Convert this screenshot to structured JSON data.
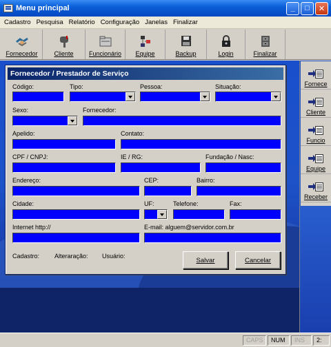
{
  "window": {
    "title": "Menu principal",
    "minimize": "_",
    "maximize": "□",
    "close": "✕"
  },
  "menu": [
    "Cadastro",
    "Pesquisa",
    "Relatório",
    "Configuração",
    "Janelas",
    "Finalizar"
  ],
  "toolbar": [
    {
      "label": "Fornecedor",
      "icon": "handshake-icon"
    },
    {
      "label": "Cliente",
      "icon": "mailbox-icon"
    },
    {
      "label": "Funcionário",
      "icon": "folder-icon"
    },
    {
      "label": "Equipe",
      "icon": "network-icon"
    },
    {
      "label": "Backup",
      "icon": "floppy-icon"
    },
    {
      "label": "Login",
      "icon": "lock-icon"
    },
    {
      "label": "Finalizar",
      "icon": "cabinet-icon"
    }
  ],
  "side": [
    "Fornece",
    "Cliente",
    "Funcio",
    "Equipe",
    "Receber"
  ],
  "status": [
    "CAPS",
    "NUM",
    "INS",
    "2:"
  ],
  "dialog": {
    "title": "Fornecedor / Prestador de Serviço",
    "labels": {
      "codigo": "Código:",
      "tipo": "Tipo:",
      "pessoa": "Pessoa:",
      "situacao": "Situação:",
      "sexo": "Sexo:",
      "fornecedor": "Fornecedor:",
      "apelido": "Apelido:",
      "contato": "Contato:",
      "cpf": "CPF / CNPJ:",
      "ie": "IE / RG:",
      "fundacao": "Fundação / Nasc:",
      "endereco": "Endereço:",
      "cep": "CEP:",
      "bairro": "Bairro:",
      "cidade": "Cidade:",
      "uf": "UF:",
      "telefone": "Telefone:",
      "fax": "Fax:",
      "internet": "Internet http://",
      "email": "E-mail: alguem@servidor.com.br",
      "cadastro": "Cadastro:",
      "alteracao": "Alteraração:",
      "usuario": "Usuário:"
    },
    "buttons": {
      "save": "Salvar",
      "cancel": "Cancelar"
    }
  }
}
